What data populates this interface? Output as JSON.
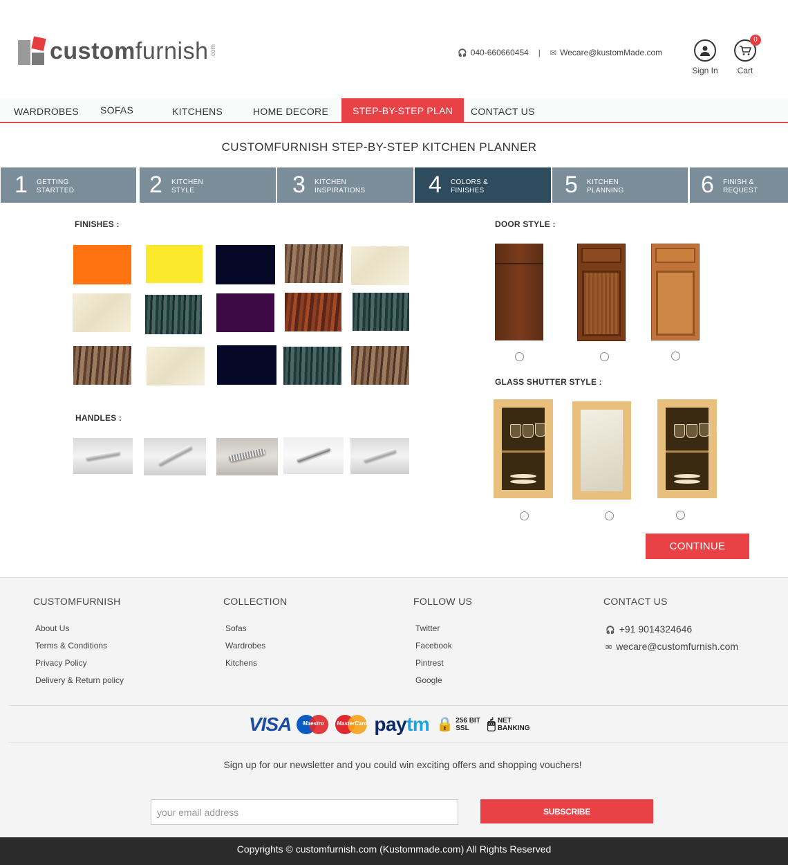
{
  "header": {
    "logo_bold": "custom",
    "logo_light": "furnish",
    "logo_suffix": ".com",
    "phone": "040-660660454",
    "separator": "|",
    "email": "Wecare@kustomMade.com",
    "sign_in": "Sign In",
    "cart": "Cart",
    "cart_count": "0"
  },
  "nav": {
    "items": [
      "WARDROBES",
      "SOFAS",
      "KITCHENS",
      "HOME DECORE",
      "STEP-BY-STEP PLAN",
      "CONTACT US"
    ],
    "active_index": 4,
    "accent_color": "#e84146"
  },
  "planner": {
    "title": "CUSTOMFURNISH STEP-BY-STEP KITCHEN PLANNER",
    "steps": [
      {
        "num": "1",
        "line1": "GETTING",
        "line2": "STARTTED"
      },
      {
        "num": "2",
        "line1": "KITCHEN",
        "line2": "STYLE"
      },
      {
        "num": "3",
        "line1": "KITCHEN",
        "line2": "INSPIRATIONS"
      },
      {
        "num": "4",
        "line1": "COLORS &",
        "line2": "FINISHES"
      },
      {
        "num": "5",
        "line1": "KITCHEN",
        "line2": "PLANNING"
      },
      {
        "num": "6",
        "line1": "FINISH &",
        "line2": "REQUEST"
      }
    ],
    "active_step": 4,
    "finishes_label": "FINISHES  :",
    "handles_label": "HANDLES  :",
    "door_style_label": "DOOR STYLE :",
    "glass_label": "GLASS SHUTTER  STYLE :",
    "continue": "CONTINUE",
    "finish_colors": [
      "#ff7310",
      "#fbe92c",
      "#050826",
      "wood-light",
      "cream",
      "cream",
      "teal-wood",
      "#3d0a45",
      "red-wood",
      "teal-wood",
      "wood-light",
      "cream",
      "#050826",
      "teal-wood",
      "wood-light"
    ]
  },
  "footer": {
    "col1": {
      "title": "CUSTOMFURNISH",
      "links": [
        "About Us",
        "Terms & Conditions",
        "Privacy Policy",
        "Delivery & Return policy"
      ]
    },
    "col2": {
      "title": "COLLECTION",
      "links": [
        "Sofas",
        "Wardrobes",
        "Kitchens"
      ]
    },
    "col3": {
      "title": "FOLLOW US",
      "links": [
        "Twitter",
        "Facebook",
        "Pintrest",
        "Google"
      ]
    },
    "col4": {
      "title": "CONTACT US",
      "phone": "+91 9014324646",
      "email": "wecare@customfurnish.com"
    },
    "payments": {
      "visa": "VISA",
      "maestro": "Maestro",
      "mastercard": "MasterCard",
      "paytm_a": "pay",
      "paytm_b": "tm",
      "ssl_1": "256 BIT",
      "ssl_2": "SSL",
      "net_1": "NET",
      "net_2": "BANKING"
    },
    "newsletter_text": "Sign up for our newsletter and you could win exciting offers and shopping vouchers!",
    "email_placeholder": "your email address",
    "subscribe": "SUBSCRIBE",
    "copyright": "Copyrights © customfurnish.com (Kustommade.com) All Rights Reserved"
  }
}
